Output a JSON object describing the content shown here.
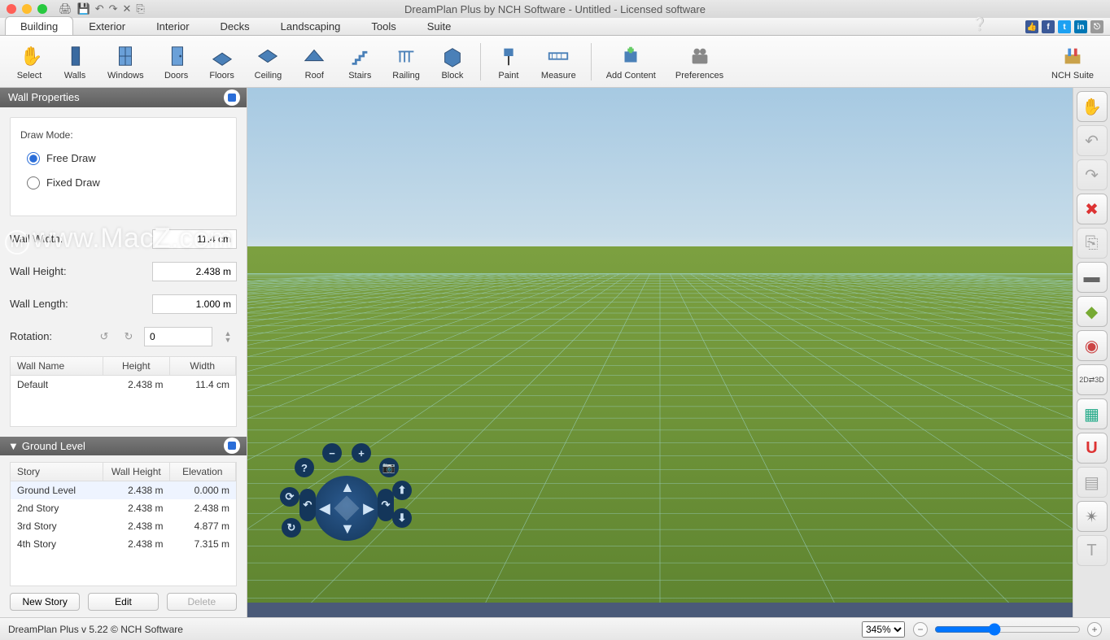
{
  "title": "DreamPlan Plus by NCH Software - Untitled - Licensed software",
  "menubar": [
    "Building",
    "Exterior",
    "Interior",
    "Decks",
    "Landscaping",
    "Tools",
    "Suite"
  ],
  "active_tab": 0,
  "ribbon": [
    {
      "label": "Select",
      "icon": "hand"
    },
    {
      "label": "Walls",
      "icon": "wall"
    },
    {
      "label": "Windows",
      "icon": "window"
    },
    {
      "label": "Doors",
      "icon": "door"
    },
    {
      "label": "Floors",
      "icon": "floor"
    },
    {
      "label": "Ceiling",
      "icon": "ceiling"
    },
    {
      "label": "Roof",
      "icon": "roof"
    },
    {
      "label": "Stairs",
      "icon": "stairs"
    },
    {
      "label": "Railing",
      "icon": "railing"
    },
    {
      "label": "Block",
      "icon": "block"
    }
  ],
  "ribbon2": [
    {
      "label": "Paint",
      "icon": "paint"
    },
    {
      "label": "Measure",
      "icon": "measure"
    }
  ],
  "ribbon3": [
    {
      "label": "Add Content",
      "icon": "addcontent"
    },
    {
      "label": "Preferences",
      "icon": "prefs"
    }
  ],
  "ribbon_right": {
    "label": "NCH Suite",
    "icon": "suite"
  },
  "wall_panel": {
    "title": "Wall Properties",
    "draw_mode_label": "Draw Mode:",
    "opt_free": "Free Draw",
    "opt_fixed": "Fixed Draw",
    "width_label": "Wall Width:",
    "width_value": "11.4 cm",
    "height_label": "Wall Height:",
    "height_value": "2.438 m",
    "length_label": "Wall Length:",
    "length_value": "1.000 m",
    "rotation_label": "Rotation:",
    "rotation_value": "0",
    "table_headers": [
      "Wall Name",
      "Height",
      "Width"
    ],
    "table_row": [
      "Default",
      "2.438 m",
      "11.4 cm"
    ]
  },
  "ground_panel": {
    "title": "Ground Level",
    "headers": [
      "Story",
      "Wall Height",
      "Elevation"
    ],
    "rows": [
      [
        "Ground Level",
        "2.438 m",
        "0.000 m"
      ],
      [
        "2nd Story",
        "2.438 m",
        "2.438 m"
      ],
      [
        "3rd Story",
        "2.438 m",
        "4.877 m"
      ],
      [
        "4th Story",
        "2.438 m",
        "7.315 m"
      ]
    ],
    "buttons": {
      "new": "New Story",
      "edit": "Edit",
      "delete": "Delete"
    }
  },
  "status": {
    "text": "DreamPlan Plus v 5.22 © NCH Software",
    "zoom": "345%"
  },
  "watermark": "www.MacZ.com",
  "social": [
    {
      "name": "like",
      "bg": "#3b5998",
      "text": "👍"
    },
    {
      "name": "facebook",
      "bg": "#3b5998",
      "text": "f"
    },
    {
      "name": "twitter",
      "bg": "#1da1f2",
      "text": "t"
    },
    {
      "name": "linkedin",
      "bg": "#0077b5",
      "text": "in"
    },
    {
      "name": "share",
      "bg": "#999",
      "text": "⎋"
    }
  ],
  "rail": [
    {
      "name": "hand-icon",
      "glyph": "✋",
      "disabled": false
    },
    {
      "name": "undo-icon",
      "glyph": "↶",
      "disabled": true
    },
    {
      "name": "redo-icon",
      "glyph": "↷",
      "disabled": true
    },
    {
      "name": "delete-icon",
      "glyph": "✖",
      "disabled": false,
      "color": "#d33"
    },
    {
      "name": "copy-icon",
      "glyph": "⎘",
      "disabled": true
    },
    {
      "name": "wall3d-icon",
      "glyph": "▬",
      "disabled": false,
      "color": "#666"
    },
    {
      "name": "terrain-icon",
      "glyph": "◆",
      "disabled": false,
      "color": "#7a3"
    },
    {
      "name": "shapes-icon",
      "glyph": "◉",
      "disabled": false,
      "color": "#c44"
    },
    {
      "name": "2d3d-icon",
      "glyph": "2D⇄3D",
      "disabled": false,
      "small": true
    },
    {
      "name": "grid-icon",
      "glyph": "▦",
      "disabled": false,
      "color": "#2a8"
    },
    {
      "name": "snap-icon",
      "glyph": "U",
      "disabled": false,
      "color": "#d33",
      "bold": true
    },
    {
      "name": "sheet-icon",
      "glyph": "▤",
      "disabled": true
    },
    {
      "name": "compass-icon",
      "glyph": "✴",
      "disabled": false,
      "color": "#888"
    },
    {
      "name": "text-icon",
      "glyph": "T",
      "disabled": true
    }
  ]
}
